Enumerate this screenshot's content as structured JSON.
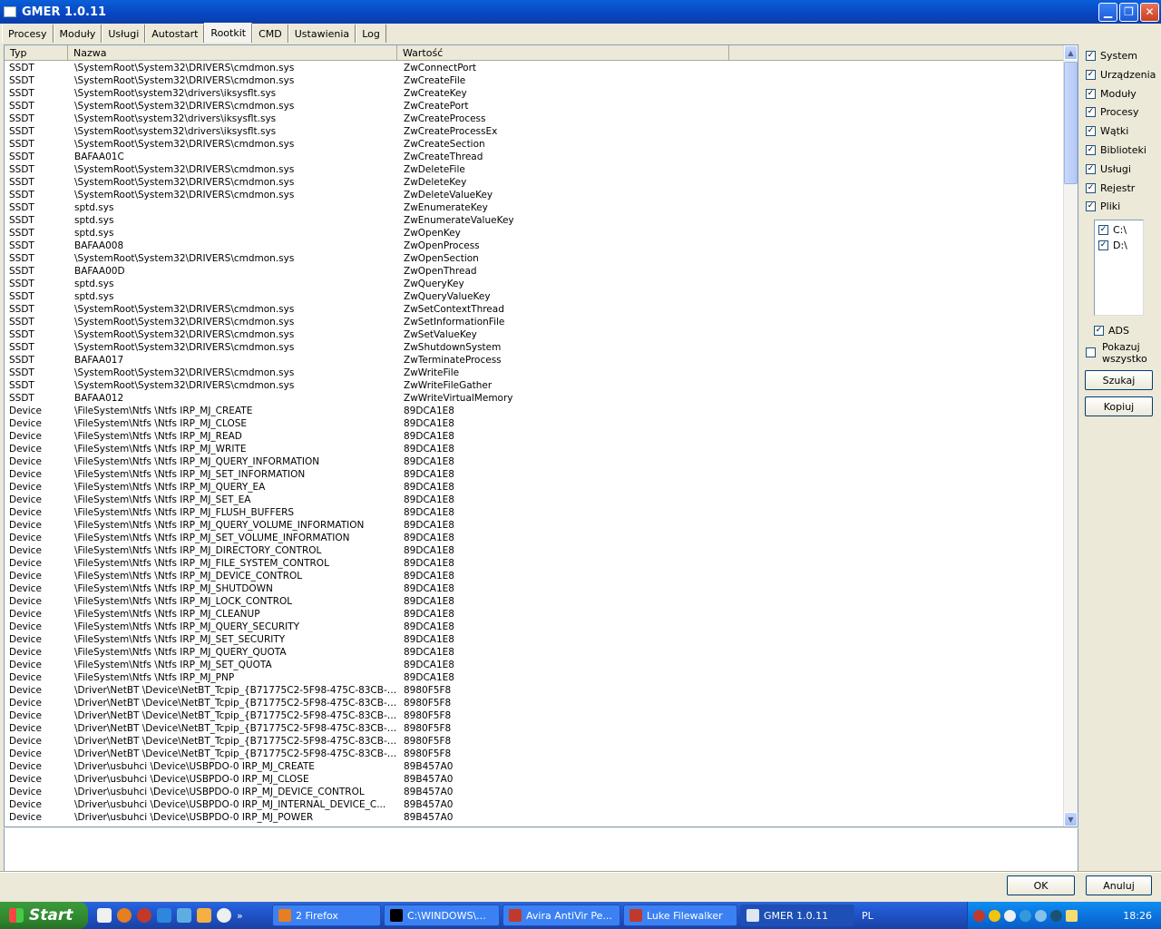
{
  "window": {
    "title": "GMER 1.0.11"
  },
  "tabs": [
    "Procesy",
    "Moduły",
    "Usługi",
    "Autostart",
    "Rootkit",
    "CMD",
    "Ustawienia",
    "Log"
  ],
  "table": {
    "headers": [
      "Typ",
      "Nazwa",
      "Wartość"
    ],
    "rows": [
      [
        "SSDT",
        "\\SystemRoot\\System32\\DRIVERS\\cmdmon.sys",
        "ZwConnectPort"
      ],
      [
        "SSDT",
        "\\SystemRoot\\System32\\DRIVERS\\cmdmon.sys",
        "ZwCreateFile"
      ],
      [
        "SSDT",
        "\\SystemRoot\\system32\\drivers\\iksysflt.sys",
        "ZwCreateKey"
      ],
      [
        "SSDT",
        "\\SystemRoot\\System32\\DRIVERS\\cmdmon.sys",
        "ZwCreatePort"
      ],
      [
        "SSDT",
        "\\SystemRoot\\system32\\drivers\\iksysflt.sys",
        "ZwCreateProcess"
      ],
      [
        "SSDT",
        "\\SystemRoot\\system32\\drivers\\iksysflt.sys",
        "ZwCreateProcessEx"
      ],
      [
        "SSDT",
        "\\SystemRoot\\System32\\DRIVERS\\cmdmon.sys",
        "ZwCreateSection"
      ],
      [
        "SSDT",
        "BAFAA01C",
        "ZwCreateThread"
      ],
      [
        "SSDT",
        "\\SystemRoot\\System32\\DRIVERS\\cmdmon.sys",
        "ZwDeleteFile"
      ],
      [
        "SSDT",
        "\\SystemRoot\\System32\\DRIVERS\\cmdmon.sys",
        "ZwDeleteKey"
      ],
      [
        "SSDT",
        "\\SystemRoot\\System32\\DRIVERS\\cmdmon.sys",
        "ZwDeleteValueKey"
      ],
      [
        "SSDT",
        "sptd.sys",
        "ZwEnumerateKey"
      ],
      [
        "SSDT",
        "sptd.sys",
        "ZwEnumerateValueKey"
      ],
      [
        "SSDT",
        "sptd.sys",
        "ZwOpenKey"
      ],
      [
        "SSDT",
        "BAFAA008",
        "ZwOpenProcess"
      ],
      [
        "SSDT",
        "\\SystemRoot\\System32\\DRIVERS\\cmdmon.sys",
        "ZwOpenSection"
      ],
      [
        "SSDT",
        "BAFAA00D",
        "ZwOpenThread"
      ],
      [
        "SSDT",
        "sptd.sys",
        "ZwQueryKey"
      ],
      [
        "SSDT",
        "sptd.sys",
        "ZwQueryValueKey"
      ],
      [
        "SSDT",
        "\\SystemRoot\\System32\\DRIVERS\\cmdmon.sys",
        "ZwSetContextThread"
      ],
      [
        "SSDT",
        "\\SystemRoot\\System32\\DRIVERS\\cmdmon.sys",
        "ZwSetInformationFile"
      ],
      [
        "SSDT",
        "\\SystemRoot\\System32\\DRIVERS\\cmdmon.sys",
        "ZwSetValueKey"
      ],
      [
        "SSDT",
        "\\SystemRoot\\System32\\DRIVERS\\cmdmon.sys",
        "ZwShutdownSystem"
      ],
      [
        "SSDT",
        "BAFAA017",
        "ZwTerminateProcess"
      ],
      [
        "SSDT",
        "\\SystemRoot\\System32\\DRIVERS\\cmdmon.sys",
        "ZwWriteFile"
      ],
      [
        "SSDT",
        "\\SystemRoot\\System32\\DRIVERS\\cmdmon.sys",
        "ZwWriteFileGather"
      ],
      [
        "SSDT",
        "BAFAA012",
        "ZwWriteVirtualMemory"
      ],
      [
        "Device",
        "\\FileSystem\\Ntfs \\Ntfs IRP_MJ_CREATE",
        "89DCA1E8"
      ],
      [
        "Device",
        "\\FileSystem\\Ntfs \\Ntfs IRP_MJ_CLOSE",
        "89DCA1E8"
      ],
      [
        "Device",
        "\\FileSystem\\Ntfs \\Ntfs IRP_MJ_READ",
        "89DCA1E8"
      ],
      [
        "Device",
        "\\FileSystem\\Ntfs \\Ntfs IRP_MJ_WRITE",
        "89DCA1E8"
      ],
      [
        "Device",
        "\\FileSystem\\Ntfs \\Ntfs IRP_MJ_QUERY_INFORMATION",
        "89DCA1E8"
      ],
      [
        "Device",
        "\\FileSystem\\Ntfs \\Ntfs IRP_MJ_SET_INFORMATION",
        "89DCA1E8"
      ],
      [
        "Device",
        "\\FileSystem\\Ntfs \\Ntfs IRP_MJ_QUERY_EA",
        "89DCA1E8"
      ],
      [
        "Device",
        "\\FileSystem\\Ntfs \\Ntfs IRP_MJ_SET_EA",
        "89DCA1E8"
      ],
      [
        "Device",
        "\\FileSystem\\Ntfs \\Ntfs IRP_MJ_FLUSH_BUFFERS",
        "89DCA1E8"
      ],
      [
        "Device",
        "\\FileSystem\\Ntfs \\Ntfs IRP_MJ_QUERY_VOLUME_INFORMATION",
        "89DCA1E8"
      ],
      [
        "Device",
        "\\FileSystem\\Ntfs \\Ntfs IRP_MJ_SET_VOLUME_INFORMATION",
        "89DCA1E8"
      ],
      [
        "Device",
        "\\FileSystem\\Ntfs \\Ntfs IRP_MJ_DIRECTORY_CONTROL",
        "89DCA1E8"
      ],
      [
        "Device",
        "\\FileSystem\\Ntfs \\Ntfs IRP_MJ_FILE_SYSTEM_CONTROL",
        "89DCA1E8"
      ],
      [
        "Device",
        "\\FileSystem\\Ntfs \\Ntfs IRP_MJ_DEVICE_CONTROL",
        "89DCA1E8"
      ],
      [
        "Device",
        "\\FileSystem\\Ntfs \\Ntfs IRP_MJ_SHUTDOWN",
        "89DCA1E8"
      ],
      [
        "Device",
        "\\FileSystem\\Ntfs \\Ntfs IRP_MJ_LOCK_CONTROL",
        "89DCA1E8"
      ],
      [
        "Device",
        "\\FileSystem\\Ntfs \\Ntfs IRP_MJ_CLEANUP",
        "89DCA1E8"
      ],
      [
        "Device",
        "\\FileSystem\\Ntfs \\Ntfs IRP_MJ_QUERY_SECURITY",
        "89DCA1E8"
      ],
      [
        "Device",
        "\\FileSystem\\Ntfs \\Ntfs IRP_MJ_SET_SECURITY",
        "89DCA1E8"
      ],
      [
        "Device",
        "\\FileSystem\\Ntfs \\Ntfs IRP_MJ_QUERY_QUOTA",
        "89DCA1E8"
      ],
      [
        "Device",
        "\\FileSystem\\Ntfs \\Ntfs IRP_MJ_SET_QUOTA",
        "89DCA1E8"
      ],
      [
        "Device",
        "\\FileSystem\\Ntfs \\Ntfs IRP_MJ_PNP",
        "89DCA1E8"
      ],
      [
        "Device",
        "\\Driver\\NetBT \\Device\\NetBT_Tcpip_{B71775C2-5F98-475C-83CB-2B...",
        "8980F5F8"
      ],
      [
        "Device",
        "\\Driver\\NetBT \\Device\\NetBT_Tcpip_{B71775C2-5F98-475C-83CB-2B...",
        "8980F5F8"
      ],
      [
        "Device",
        "\\Driver\\NetBT \\Device\\NetBT_Tcpip_{B71775C2-5F98-475C-83CB-2B...",
        "8980F5F8"
      ],
      [
        "Device",
        "\\Driver\\NetBT \\Device\\NetBT_Tcpip_{B71775C2-5F98-475C-83CB-2B...",
        "8980F5F8"
      ],
      [
        "Device",
        "\\Driver\\NetBT \\Device\\NetBT_Tcpip_{B71775C2-5F98-475C-83CB-2B...",
        "8980F5F8"
      ],
      [
        "Device",
        "\\Driver\\NetBT \\Device\\NetBT_Tcpip_{B71775C2-5F98-475C-83CB-2B...",
        "8980F5F8"
      ],
      [
        "Device",
        "\\Driver\\usbuhci \\Device\\USBPDO-0 IRP_MJ_CREATE",
        "89B457A0"
      ],
      [
        "Device",
        "\\Driver\\usbuhci \\Device\\USBPDO-0 IRP_MJ_CLOSE",
        "89B457A0"
      ],
      [
        "Device",
        "\\Driver\\usbuhci \\Device\\USBPDO-0 IRP_MJ_DEVICE_CONTROL",
        "89B457A0"
      ],
      [
        "Device",
        "\\Driver\\usbuhci \\Device\\USBPDO-0 IRP_MJ_INTERNAL_DEVICE_C...",
        "89B457A0"
      ],
      [
        "Device",
        "\\Driver\\usbuhci \\Device\\USBPDO-0 IRP_MJ_POWER",
        "89B457A0"
      ]
    ]
  },
  "options": {
    "checkboxes": [
      {
        "label": "System",
        "checked": true
      },
      {
        "label": "Urządzenia",
        "checked": true
      },
      {
        "label": "Moduły",
        "checked": true
      },
      {
        "label": "Procesy",
        "checked": true
      },
      {
        "label": "Wątki",
        "checked": true
      },
      {
        "label": "Biblioteki",
        "checked": true
      },
      {
        "label": "Usługi",
        "checked": true
      },
      {
        "label": "Rejestr",
        "checked": true
      },
      {
        "label": "Pliki",
        "checked": true
      }
    ],
    "drives": [
      {
        "label": "C:\\",
        "checked": true
      },
      {
        "label": "D:\\",
        "checked": true
      }
    ],
    "ads": {
      "label": "ADS",
      "checked": true
    },
    "show_all": {
      "line1": "Pokazuj",
      "line2": "wszystko",
      "checked": false
    },
    "search_label": "Szukaj",
    "copy_label": "Kopiuj"
  },
  "dialog": {
    "ok_label": "OK",
    "cancel_label": "Anuluj"
  },
  "taskbar": {
    "start_label": "Start",
    "tasks": [
      {
        "label": "2 Firefox",
        "icon": "firefox-icon",
        "active": false
      },
      {
        "label": "C:\\WINDOWS\\...",
        "icon": "cmd-icon",
        "active": false
      },
      {
        "label": "Avira AntiVir Pe...",
        "icon": "avira-icon",
        "active": false
      },
      {
        "label": "Luke Filewalker",
        "icon": "avira-icon",
        "active": false
      },
      {
        "label": "GMER 1.0.11",
        "icon": "window-icon",
        "active": true
      }
    ],
    "language": "PL",
    "clock": "18:26"
  },
  "colors": {
    "titlebar": "#0a5fd8",
    "taskbar": "#245edb",
    "start": "#3c9a3c",
    "tray": "#0b74df"
  }
}
